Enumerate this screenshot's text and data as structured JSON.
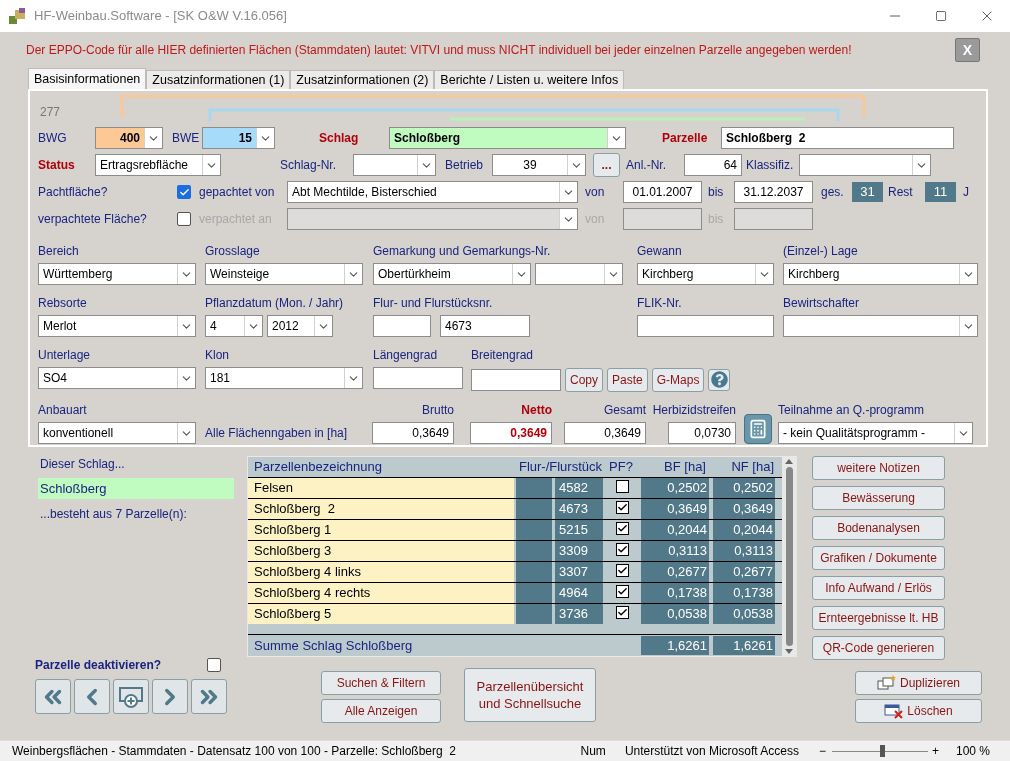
{
  "window": {
    "title": "HF-Weinbau.Software - [SK O&W V.16.056]"
  },
  "notice": "Der EPPO-Code für alle HIER definierten Flächen (Stammdaten) lautet: VITVI und muss NICHT individuell bei jeder einzelnen Parzelle angegeben werden!",
  "close_button": "X",
  "tabs": [
    {
      "label": "Basisinformationen",
      "selected": true
    },
    {
      "label": "Zusatzinformationen (1)",
      "selected": false
    },
    {
      "label": "Zusatzinformationen (2)",
      "selected": false
    },
    {
      "label": "Berichte / Listen u. weitere Infos",
      "selected": false
    }
  ],
  "record_number": "277",
  "header": {
    "bwg": {
      "label": "BWG",
      "value": "400"
    },
    "bwe": {
      "label": "BWE",
      "value": "15"
    },
    "schlag": {
      "label": "Schlag",
      "value": "Schloßberg"
    },
    "parzelle": {
      "label": "Parzelle",
      "value": "Schloßberg  2"
    },
    "status": {
      "label": "Status",
      "value": "Ertragsrebfläche"
    },
    "schlag_nr": {
      "label": "Schlag-Nr."
    },
    "betrieb": {
      "label": "Betrieb",
      "value": "39"
    },
    "lookup_button": "...",
    "anl_nr": {
      "label": "Anl.-Nr.",
      "value": "64"
    },
    "klassifiz": {
      "label": "Klassifiz."
    }
  },
  "lease": [
    {
      "label": "Pachtfläche?",
      "checked": true,
      "party_label": "gepachtet von",
      "party": "Abt Mechtilde, Bisterschied",
      "from_label": "von",
      "from": "01.01.2007",
      "to_label": "bis",
      "to": "31.12.2037",
      "total_label": "ges.",
      "total": "31",
      "rest_label": "Rest",
      "rest": "11",
      "unit": "J"
    },
    {
      "label": "verpachtete Fläche?",
      "checked": false,
      "party_label": "verpachtet an",
      "from_label": "von",
      "to_label": "bis"
    }
  ],
  "location_rows": [
    [
      {
        "label": "Bereich",
        "controls": [
          {
            "kind": "combo",
            "value": "Württemberg"
          }
        ]
      },
      {
        "label": "Grosslage",
        "controls": [
          {
            "kind": "combo",
            "value": "Weinsteige"
          }
        ]
      },
      {
        "label": "Gemarkung und Gemarkungs-Nr.",
        "controls": [
          {
            "kind": "combo",
            "value": "Obertürkheim"
          },
          {
            "kind": "combo"
          }
        ]
      },
      {
        "label": "Gewann",
        "controls": [
          {
            "kind": "combo",
            "value": "Kirchberg"
          }
        ]
      },
      {
        "label": "(Einzel-) Lage",
        "controls": [
          {
            "kind": "combo",
            "value": "Kirchberg"
          }
        ]
      }
    ],
    [
      {
        "label": "Rebsorte",
        "controls": [
          {
            "kind": "combo",
            "value": "Merlot"
          }
        ]
      },
      {
        "label": "Pflanzdatum (Mon. / Jahr)",
        "controls": [
          {
            "kind": "combo",
            "value": "4"
          },
          {
            "kind": "combo",
            "value": "2012"
          }
        ]
      },
      {
        "label": "Flur- und Flurstücksnr.",
        "controls": [
          {
            "kind": "input"
          },
          {
            "kind": "input",
            "value": "4673"
          }
        ]
      },
      {
        "label": "FLIK-Nr.",
        "controls": [
          {
            "kind": "input"
          }
        ]
      },
      {
        "label": "Bewirtschafter",
        "controls": [
          {
            "kind": "combo"
          }
        ]
      }
    ],
    [
      {
        "label": "Unterlage",
        "controls": [
          {
            "kind": "combo",
            "value": "SO4"
          }
        ]
      },
      {
        "label": "Klon",
        "controls": [
          {
            "kind": "combo",
            "value": "181"
          }
        ]
      },
      {
        "label": "Längengrad",
        "controls": [
          {
            "kind": "input"
          }
        ]
      },
      {
        "label": "Breitengrad",
        "controls": [
          {
            "kind": "input"
          },
          {
            "kind": "button",
            "value": "Copy"
          },
          {
            "kind": "button",
            "value": "Paste"
          },
          {
            "kind": "button",
            "value": "G-Maps"
          },
          {
            "kind": "help"
          }
        ]
      }
    ]
  ],
  "areas": {
    "anbauart": {
      "label": "Anbauart",
      "value": "konventionell"
    },
    "note": "Alle Flächenngaben in [ha]",
    "values": [
      {
        "label": "Brutto",
        "value": "0,3649",
        "highlight": false
      },
      {
        "label": "Netto",
        "value": "0,3649",
        "highlight": true
      },
      {
        "label": "Gesamt",
        "value": "0,3649",
        "highlight": false
      },
      {
        "label": "Herbizidstreifen",
        "value": "0,0730",
        "highlight": false
      }
    ],
    "program": {
      "label": "Teilnahme an Q.-programm",
      "value": "- kein Qualitätsprogramm -"
    }
  },
  "parcels": {
    "intro": "Dieser Schlag...",
    "field": "Schloßberg",
    "summary": "...besteht aus 7 Parzelle(n):",
    "columns": [
      "Parzellenbezeichnung",
      "Flur-/Flurstück",
      "PF?",
      "BF [ha]",
      "NF [ha]"
    ],
    "rows": [
      {
        "name": "Felsen",
        "flur": "4582",
        "pf": false,
        "bf": "0,2502",
        "nf": "0,2502"
      },
      {
        "name": "Schloßberg  2",
        "flur": "4673",
        "pf": true,
        "bf": "0,3649",
        "nf": "0,3649"
      },
      {
        "name": "Schloßberg 1",
        "flur": "5215",
        "pf": true,
        "bf": "0,2044",
        "nf": "0,2044"
      },
      {
        "name": "Schloßberg 3",
        "flur": "3309",
        "pf": true,
        "bf": "0,3113",
        "nf": "0,3113"
      },
      {
        "name": "Schloßberg 4 links",
        "flur": "3307",
        "pf": true,
        "bf": "0,2677",
        "nf": "0,2677"
      },
      {
        "name": "Schloßberg 4 rechts",
        "flur": "4964",
        "pf": true,
        "bf": "0,1738",
        "nf": "0,1738"
      },
      {
        "name": "Schloßberg 5",
        "flur": "3736",
        "pf": true,
        "bf": "0,0538",
        "nf": "0,0538"
      }
    ],
    "total": {
      "label": "Summe Schlag Schloßberg",
      "bf": "1,6261",
      "nf": "1,6261"
    }
  },
  "side_buttons": [
    "weitere Notizen",
    "Bewässerung",
    "Bodenanalysen",
    "Grafiken / Dokumente",
    "Info Aufwand / Erlös",
    "Ernteergebnisse lt. HB",
    "QR-Code generieren"
  ],
  "deactivate": {
    "label": "Parzelle deaktivieren?",
    "checked": false
  },
  "nav": [
    {
      "kind": "first"
    },
    {
      "kind": "previous"
    },
    {
      "kind": "new"
    },
    {
      "kind": "next"
    },
    {
      "kind": "last"
    }
  ],
  "search_buttons": [
    "Suchen & Filtern",
    "Alle Anzeigen"
  ],
  "overview_button": "Parzellenübersicht und Schnellsuche",
  "actions": [
    {
      "kind": "duplicate",
      "label": "Duplizieren"
    },
    {
      "kind": "delete",
      "label": "Löschen"
    }
  ],
  "status_bar": {
    "text": "Weinbergsflächen - Stammdaten - Datensatz 100 von 100 - Parzelle: Schloßberg  2",
    "mode": "Num",
    "credit": "Unterstützt von Microsoft Access",
    "zoom_out": "−",
    "zoom_in": "+",
    "zoom": {
      "level": 0.52
    },
    "zoom_label": "100 %"
  }
}
